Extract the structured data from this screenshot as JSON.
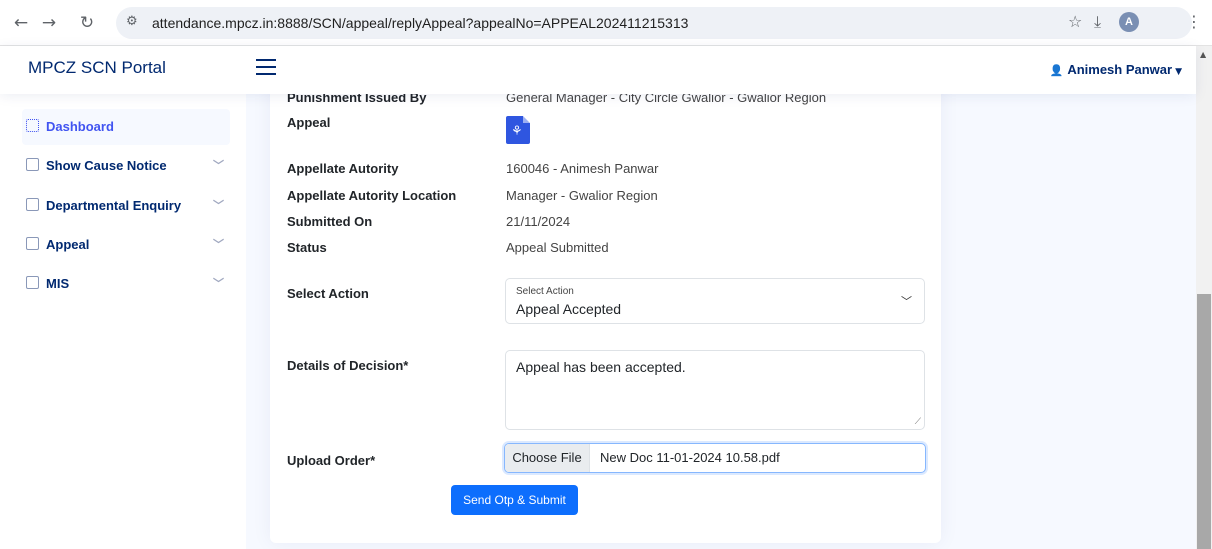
{
  "browser": {
    "url": "attendance.mpcz.in:8888/SCN/appeal/replyAppeal?appealNo=APPEAL202411215313",
    "profile_initial": "A"
  },
  "header": {
    "brand": "MPCZ SCN Portal",
    "user_name": "Animesh Panwar"
  },
  "sidebar": {
    "items": [
      {
        "label": "Dashboard",
        "icon": "grid-icon"
      },
      {
        "label": "Show Cause Notice",
        "icon": "layout-icon"
      },
      {
        "label": "Departmental Enquiry",
        "icon": "file-icon"
      },
      {
        "label": "Appeal",
        "icon": "file-icon"
      },
      {
        "label": "MIS",
        "icon": "layout-icon"
      }
    ]
  },
  "details": {
    "punishment_label": "Punishment Issued By",
    "punishment_value": "General Manager - City Circle Gwalior - Gwalior Region",
    "appeal_label": "Appeal",
    "authority_label": "Appellate Autority",
    "authority_value": "160046 - Animesh Panwar",
    "location_label": "Appellate Autority Location",
    "location_value": "Manager - Gwalior Region",
    "submitted_label": "Submitted On",
    "submitted_value": "21/11/2024",
    "status_label": "Status",
    "status_value": "Appeal Submitted"
  },
  "form": {
    "action_label": "Select Action",
    "action_float_label": "Select Action",
    "action_value": "Appeal Accepted",
    "decision_label": "Details of Decision*",
    "decision_value": "Appeal has been accepted.",
    "upload_label": "Upload Order*",
    "choose_file": "Choose File",
    "file_name": "New Doc 11-01-2024 10.58.pdf",
    "submit_label": "Send Otp & Submit"
  },
  "colors": {
    "primary": "#0d6efd",
    "brand": "#012970",
    "pdf": "#2f56e0"
  }
}
